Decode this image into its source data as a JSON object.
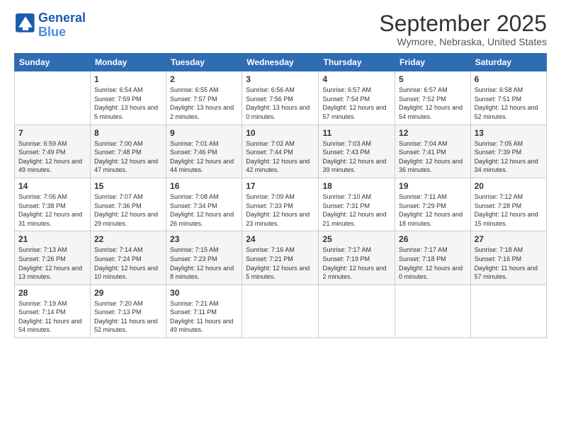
{
  "header": {
    "logo_line1": "General",
    "logo_line2": "Blue",
    "month": "September 2025",
    "location": "Wymore, Nebraska, United States"
  },
  "weekdays": [
    "Sunday",
    "Monday",
    "Tuesday",
    "Wednesday",
    "Thursday",
    "Friday",
    "Saturday"
  ],
  "weeks": [
    [
      {
        "day": "",
        "sunrise": "",
        "sunset": "",
        "daylight": ""
      },
      {
        "day": "1",
        "sunrise": "Sunrise: 6:54 AM",
        "sunset": "Sunset: 7:59 PM",
        "daylight": "Daylight: 13 hours and 5 minutes."
      },
      {
        "day": "2",
        "sunrise": "Sunrise: 6:55 AM",
        "sunset": "Sunset: 7:57 PM",
        "daylight": "Daylight: 13 hours and 2 minutes."
      },
      {
        "day": "3",
        "sunrise": "Sunrise: 6:56 AM",
        "sunset": "Sunset: 7:56 PM",
        "daylight": "Daylight: 13 hours and 0 minutes."
      },
      {
        "day": "4",
        "sunrise": "Sunrise: 6:57 AM",
        "sunset": "Sunset: 7:54 PM",
        "daylight": "Daylight: 12 hours and 57 minutes."
      },
      {
        "day": "5",
        "sunrise": "Sunrise: 6:57 AM",
        "sunset": "Sunset: 7:52 PM",
        "daylight": "Daylight: 12 hours and 54 minutes."
      },
      {
        "day": "6",
        "sunrise": "Sunrise: 6:58 AM",
        "sunset": "Sunset: 7:51 PM",
        "daylight": "Daylight: 12 hours and 52 minutes."
      }
    ],
    [
      {
        "day": "7",
        "sunrise": "Sunrise: 6:59 AM",
        "sunset": "Sunset: 7:49 PM",
        "daylight": "Daylight: 12 hours and 49 minutes."
      },
      {
        "day": "8",
        "sunrise": "Sunrise: 7:00 AM",
        "sunset": "Sunset: 7:48 PM",
        "daylight": "Daylight: 12 hours and 47 minutes."
      },
      {
        "day": "9",
        "sunrise": "Sunrise: 7:01 AM",
        "sunset": "Sunset: 7:46 PM",
        "daylight": "Daylight: 12 hours and 44 minutes."
      },
      {
        "day": "10",
        "sunrise": "Sunrise: 7:02 AM",
        "sunset": "Sunset: 7:44 PM",
        "daylight": "Daylight: 12 hours and 42 minutes."
      },
      {
        "day": "11",
        "sunrise": "Sunrise: 7:03 AM",
        "sunset": "Sunset: 7:43 PM",
        "daylight": "Daylight: 12 hours and 39 minutes."
      },
      {
        "day": "12",
        "sunrise": "Sunrise: 7:04 AM",
        "sunset": "Sunset: 7:41 PM",
        "daylight": "Daylight: 12 hours and 36 minutes."
      },
      {
        "day": "13",
        "sunrise": "Sunrise: 7:05 AM",
        "sunset": "Sunset: 7:39 PM",
        "daylight": "Daylight: 12 hours and 34 minutes."
      }
    ],
    [
      {
        "day": "14",
        "sunrise": "Sunrise: 7:06 AM",
        "sunset": "Sunset: 7:38 PM",
        "daylight": "Daylight: 12 hours and 31 minutes."
      },
      {
        "day": "15",
        "sunrise": "Sunrise: 7:07 AM",
        "sunset": "Sunset: 7:36 PM",
        "daylight": "Daylight: 12 hours and 29 minutes."
      },
      {
        "day": "16",
        "sunrise": "Sunrise: 7:08 AM",
        "sunset": "Sunset: 7:34 PM",
        "daylight": "Daylight: 12 hours and 26 minutes."
      },
      {
        "day": "17",
        "sunrise": "Sunrise: 7:09 AM",
        "sunset": "Sunset: 7:33 PM",
        "daylight": "Daylight: 12 hours and 23 minutes."
      },
      {
        "day": "18",
        "sunrise": "Sunrise: 7:10 AM",
        "sunset": "Sunset: 7:31 PM",
        "daylight": "Daylight: 12 hours and 21 minutes."
      },
      {
        "day": "19",
        "sunrise": "Sunrise: 7:11 AM",
        "sunset": "Sunset: 7:29 PM",
        "daylight": "Daylight: 12 hours and 18 minutes."
      },
      {
        "day": "20",
        "sunrise": "Sunrise: 7:12 AM",
        "sunset": "Sunset: 7:28 PM",
        "daylight": "Daylight: 12 hours and 15 minutes."
      }
    ],
    [
      {
        "day": "21",
        "sunrise": "Sunrise: 7:13 AM",
        "sunset": "Sunset: 7:26 PM",
        "daylight": "Daylight: 12 hours and 13 minutes."
      },
      {
        "day": "22",
        "sunrise": "Sunrise: 7:14 AM",
        "sunset": "Sunset: 7:24 PM",
        "daylight": "Daylight: 12 hours and 10 minutes."
      },
      {
        "day": "23",
        "sunrise": "Sunrise: 7:15 AM",
        "sunset": "Sunset: 7:23 PM",
        "daylight": "Daylight: 12 hours and 8 minutes."
      },
      {
        "day": "24",
        "sunrise": "Sunrise: 7:16 AM",
        "sunset": "Sunset: 7:21 PM",
        "daylight": "Daylight: 12 hours and 5 minutes."
      },
      {
        "day": "25",
        "sunrise": "Sunrise: 7:17 AM",
        "sunset": "Sunset: 7:19 PM",
        "daylight": "Daylight: 12 hours and 2 minutes."
      },
      {
        "day": "26",
        "sunrise": "Sunrise: 7:17 AM",
        "sunset": "Sunset: 7:18 PM",
        "daylight": "Daylight: 12 hours and 0 minutes."
      },
      {
        "day": "27",
        "sunrise": "Sunrise: 7:18 AM",
        "sunset": "Sunset: 7:16 PM",
        "daylight": "Daylight: 11 hours and 57 minutes."
      }
    ],
    [
      {
        "day": "28",
        "sunrise": "Sunrise: 7:19 AM",
        "sunset": "Sunset: 7:14 PM",
        "daylight": "Daylight: 11 hours and 54 minutes."
      },
      {
        "day": "29",
        "sunrise": "Sunrise: 7:20 AM",
        "sunset": "Sunset: 7:13 PM",
        "daylight": "Daylight: 11 hours and 52 minutes."
      },
      {
        "day": "30",
        "sunrise": "Sunrise: 7:21 AM",
        "sunset": "Sunset: 7:11 PM",
        "daylight": "Daylight: 11 hours and 49 minutes."
      },
      {
        "day": "",
        "sunrise": "",
        "sunset": "",
        "daylight": ""
      },
      {
        "day": "",
        "sunrise": "",
        "sunset": "",
        "daylight": ""
      },
      {
        "day": "",
        "sunrise": "",
        "sunset": "",
        "daylight": ""
      },
      {
        "day": "",
        "sunrise": "",
        "sunset": "",
        "daylight": ""
      }
    ]
  ]
}
